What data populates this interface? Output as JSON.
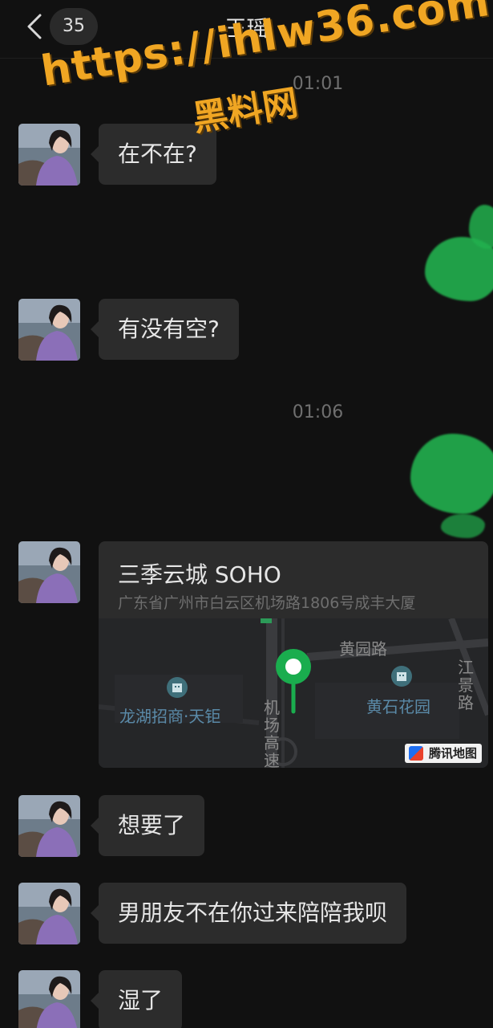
{
  "header": {
    "title": "王瑶",
    "unread_count": "35"
  },
  "watermark": {
    "url": "https://ihlw36.com",
    "name": "黑料网"
  },
  "timestamps": [
    "01:01",
    "01:06"
  ],
  "messages": [
    {
      "text": "在不在?"
    },
    {
      "text": "有没有空?"
    },
    {
      "text": "想要了"
    },
    {
      "text": "男朋友不在你过来陪陪我呗"
    },
    {
      "text": "湿了"
    }
  ],
  "location": {
    "name": "三季云城 SOHO",
    "address": "广东省广州市白云区机场路1806号成丰大厦",
    "map_labels": {
      "road_1": "黄园路",
      "road_2": "江景路",
      "road_3": "机场高速",
      "poi_1": "龙湖招商·天钜",
      "poi_2": "黄石花园"
    },
    "attribution": "腾讯地图"
  },
  "colors": {
    "background": "#111111",
    "bubble": "#2c2c2c",
    "pin": "#1aad4e",
    "watermark": "#f0a623"
  },
  "icons": {
    "back": "chevron-left-icon",
    "map_pin": "map-pin-icon",
    "poi": "building-icon"
  }
}
